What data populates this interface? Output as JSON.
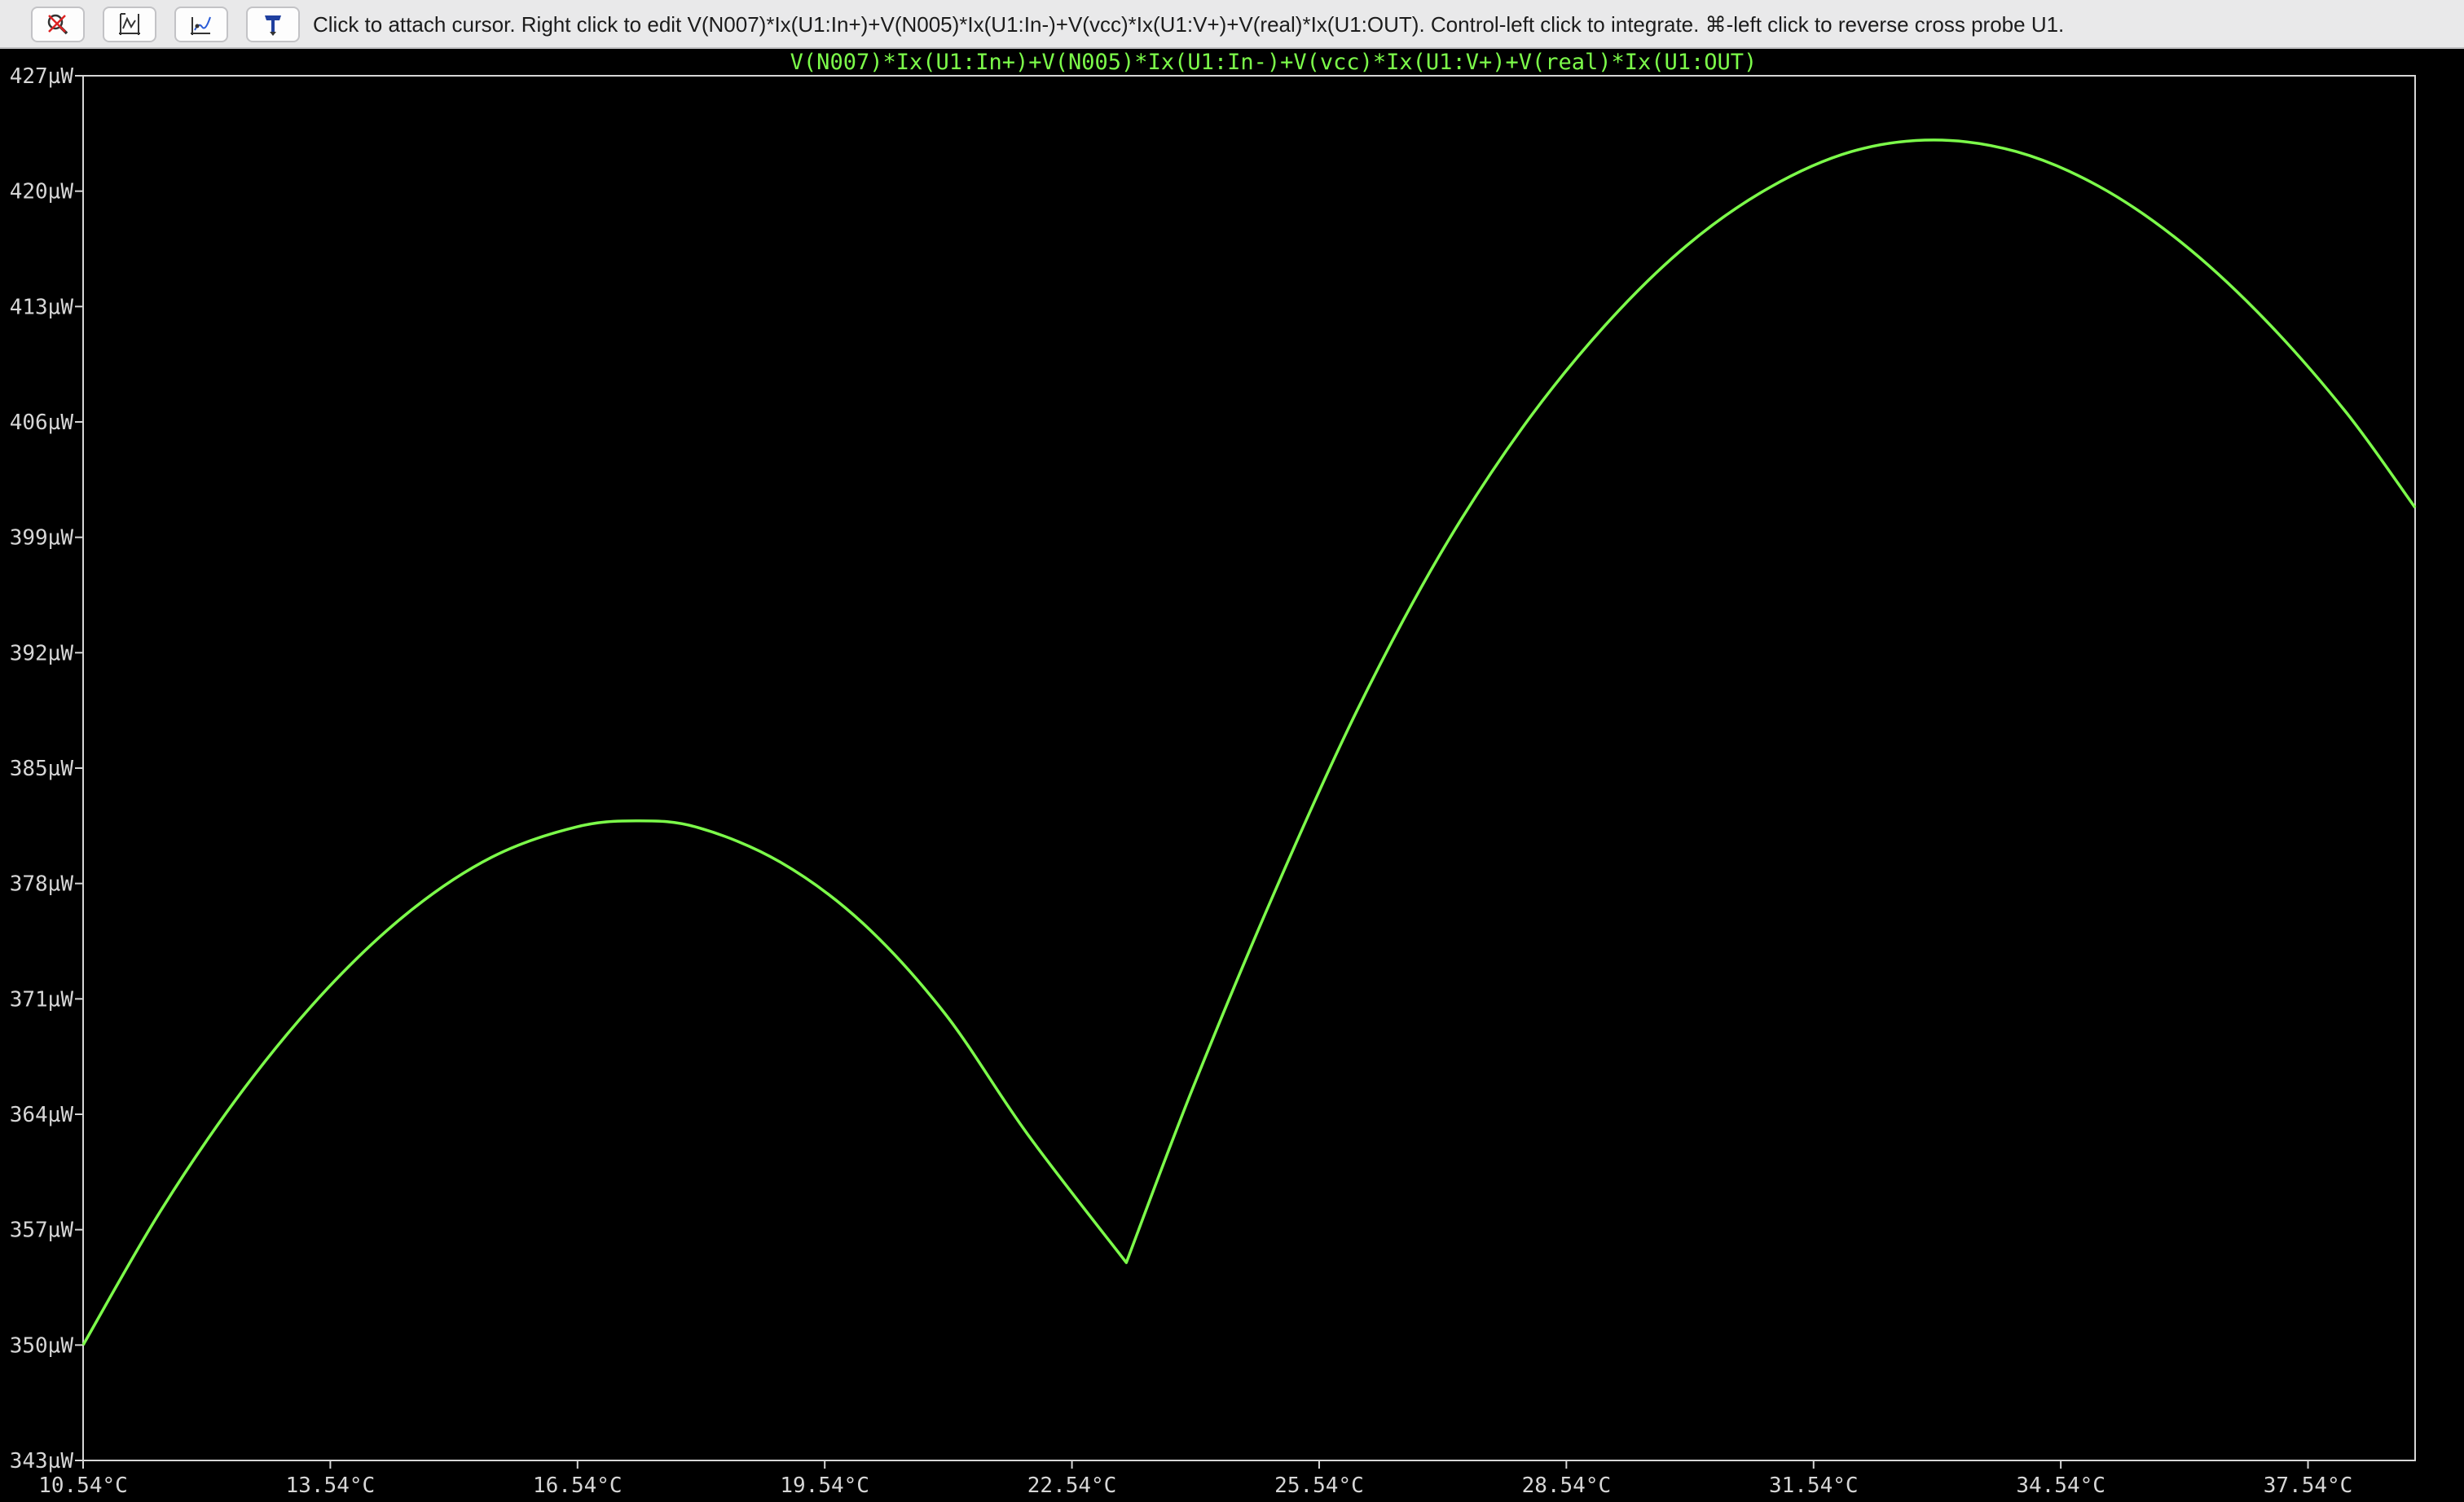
{
  "toolbar": {
    "buttons": [
      {
        "name": "zoom-cancel-icon",
        "tooltip": ""
      },
      {
        "name": "autorange-icon",
        "tooltip": ""
      },
      {
        "name": "probe-trace-icon",
        "tooltip": ""
      },
      {
        "name": "cross-probe-icon",
        "tooltip": ""
      }
    ],
    "status": "Click to attach cursor. Right click to edit V(N007)*Ix(U1:In+)+V(N005)*Ix(U1:In-)+V(vcc)*Ix(U1:V+)+V(real)*Ix(U1:OUT).  Control-left click to integrate.  ⌘-left click to reverse cross probe U1."
  },
  "colors": {
    "background": "#000000",
    "trace": "#7CFC4A",
    "axis": "#d6d6d6"
  },
  "chart_data": {
    "type": "line",
    "title": "V(N007)*Ix(U1:In+)+V(N005)*Ix(U1:In-)+V(vcc)*Ix(U1:V+)+V(real)*Ix(U1:OUT)",
    "xlabel": "",
    "ylabel": "",
    "xlim": [
      10.54,
      38.84
    ],
    "ylim": [
      343,
      427
    ],
    "x_ticks": [
      "10.54°C",
      "13.54°C",
      "16.54°C",
      "19.54°C",
      "22.54°C",
      "25.54°C",
      "28.54°C",
      "31.54°C",
      "34.54°C",
      "37.54°C"
    ],
    "x_tick_values": [
      10.54,
      13.54,
      16.54,
      19.54,
      22.54,
      25.54,
      28.54,
      31.54,
      34.54,
      37.54
    ],
    "y_ticks": [
      "427µW",
      "420µW",
      "413µW",
      "406µW",
      "399µW",
      "392µW",
      "385µW",
      "378µW",
      "371µW",
      "364µW",
      "357µW",
      "350µW",
      "343µW"
    ],
    "y_tick_values": [
      427,
      420,
      413,
      406,
      399,
      392,
      385,
      378,
      371,
      364,
      357,
      350,
      343
    ],
    "grid": false,
    "series": [
      {
        "name": "",
        "x": [
          10.54,
          11.5,
          12.5,
          13.5,
          14.5,
          15.5,
          16.5,
          17.25,
          18.0,
          19.0,
          20.0,
          21.0,
          22.0,
          23.2,
          24.0,
          25.0,
          26.0,
          27.0,
          28.0,
          29.0,
          30.0,
          31.0,
          32.0,
          33.0,
          34.0,
          35.0,
          36.0,
          37.0,
          38.0,
          38.84
        ],
        "y": [
          350.0,
          358.3,
          365.6,
          371.6,
          376.3,
          379.6,
          381.4,
          381.8,
          381.4,
          379.3,
          375.6,
          370.1,
          362.8,
          355.0,
          365.5,
          377.5,
          388.5,
          397.9,
          405.6,
          411.8,
          416.7,
          420.2,
          422.4,
          423.1,
          422.4,
          420.3,
          416.9,
          412.3,
          406.6,
          400.8
        ]
      }
    ]
  }
}
